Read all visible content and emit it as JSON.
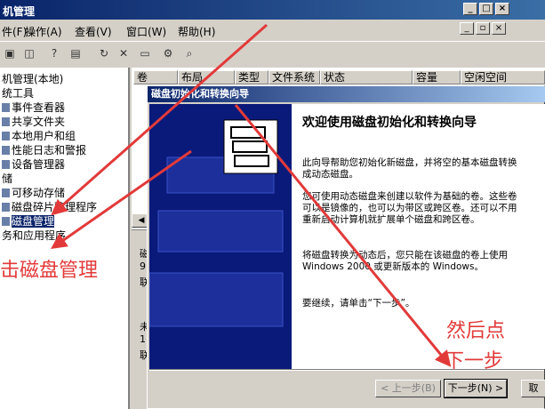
{
  "window": {
    "title": "机管理",
    "min": "_",
    "max": "□",
    "close": "×"
  },
  "mdi": {
    "min": "_",
    "restore": "▫",
    "close": "×"
  },
  "menu": [
    {
      "label": "件(F)"
    },
    {
      "label": "操作(A)"
    },
    {
      "label": "查看(V)"
    },
    {
      "label": "窗口(W)"
    },
    {
      "label": "帮助(H)"
    }
  ],
  "toolbar_icons": [
    "folder-icon",
    "panel-icon",
    "help-icon",
    "console-icon",
    "refresh-icon",
    "delete-icon",
    "folder-open-icon",
    "settings-icon",
    "magnify-icon"
  ],
  "tree": [
    {
      "label": "机管理(本地)"
    },
    {
      "label": "统工具"
    },
    {
      "label": "事件查看器"
    },
    {
      "label": "共享文件夹"
    },
    {
      "label": "本地用户和组"
    },
    {
      "label": "性能日志和警报"
    },
    {
      "label": "设备管理器"
    },
    {
      "label": "储"
    },
    {
      "label": "可移动存储"
    },
    {
      "label": "磁盘碎片整理程序"
    },
    {
      "label": "磁盘管理"
    },
    {
      "label": "务和应用程序"
    }
  ],
  "columns": [
    "卷",
    "布局",
    "类型",
    "文件系统",
    "状态",
    "容量",
    "空闲空间"
  ],
  "left_pane_glyphs": [
    "磁",
    "9",
    "联",
    "未",
    "1(",
    "联"
  ],
  "dialog": {
    "title": "磁盘初始化和转换向导",
    "heading": "欢迎使用磁盘初始化和转换向导",
    "p1": "此向导帮助您初始化新磁盘，并将空的基本磁盘转换\n成动态磁盘。",
    "p2": "您可使用动态磁盘来创建以软件为基础的卷。这些卷\n可以是镜像的，也可以为带区或跨区卷。还可以不用\n重新启动计算机就扩展单个磁盘和跨区卷。",
    "p3": "将磁盘转换为动态后，您只能在该磁盘的卷上使用\nWindows 2000 或更新版本的 Windows。",
    "p4": "要继续，请单击“下一步”。",
    "back": "< 上一步(B)",
    "next": "下一步(N) >",
    "cancel": "取"
  },
  "annotations": {
    "a1": "击磁盘管理",
    "a2": "然后点",
    "a3": "下一步"
  },
  "colors": {
    "annotation": "#e23a3a",
    "title_bar": "#0a246a",
    "selection": "#0a246a"
  }
}
